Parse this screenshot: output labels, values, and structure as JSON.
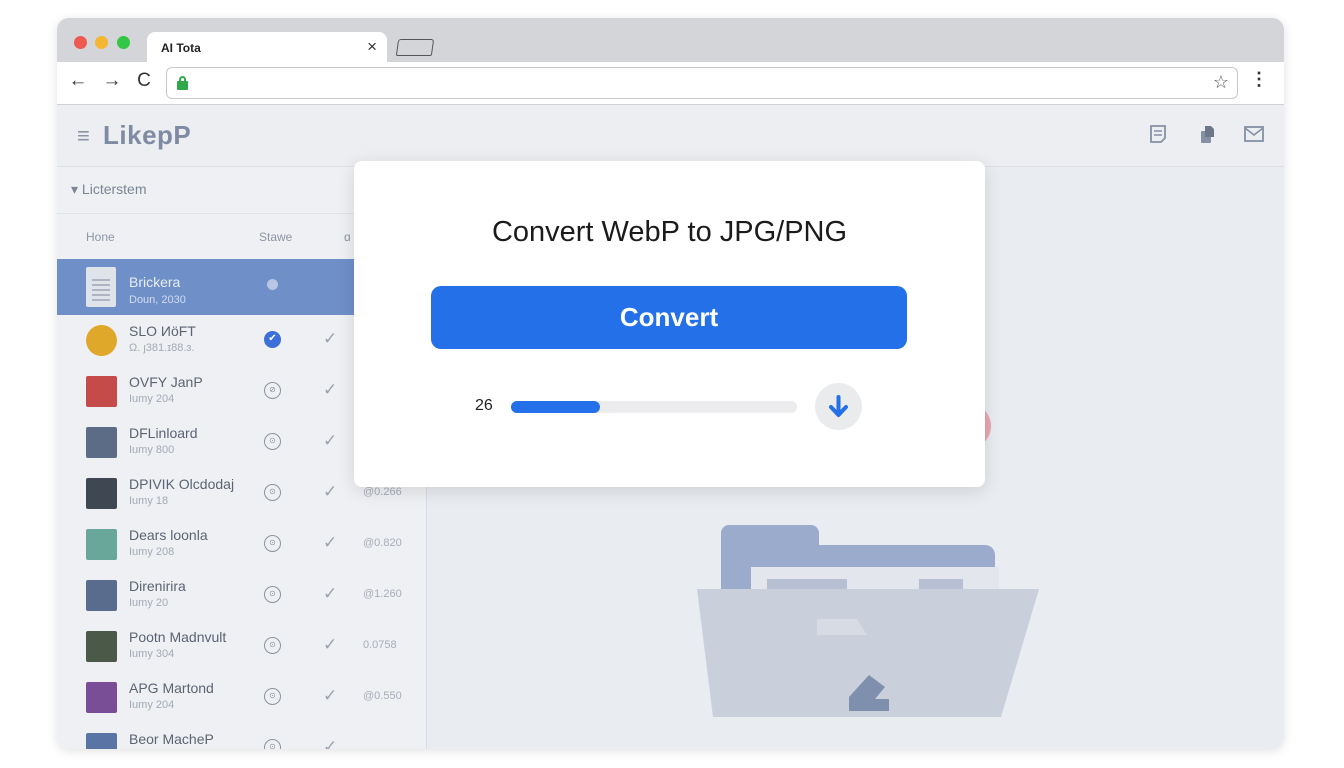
{
  "browser": {
    "tab_title": "AI Tota",
    "tab_close": "×",
    "nav": {
      "back": "←",
      "forward": "→",
      "reload": "C"
    },
    "star": "☆",
    "menu": "⋮"
  },
  "app": {
    "menu_icon": "≡",
    "logo": "LikepP",
    "header_icons": [
      "notes-icon",
      "document-share-icon",
      "mail-icon"
    ]
  },
  "sidebar": {
    "title": "▾ Licterstem",
    "columns": {
      "name": "Hone",
      "status": "Stawe",
      "extra": "ɑ"
    },
    "items": [
      {
        "name": "Brickera",
        "sub": "Doun, 2030",
        "status": "●",
        "check": "",
        "size": "",
        "selected": true,
        "icon": "document-icon"
      },
      {
        "name": "SLO ИöFT",
        "sub": "Ω. ȷ381.ɪ88.ɜ.",
        "status": "✔",
        "check": "✓",
        "size": "",
        "icon": "coin-icon",
        "color": "#e0a82a"
      },
      {
        "name": "OVFY JanP",
        "sub": "Iumy 204",
        "status": "⊘",
        "check": "✓",
        "size": "",
        "icon": "red-image-icon",
        "color": "#c54a4a"
      },
      {
        "name": "DFLinloard",
        "sub": "Iumy 800",
        "status": "⊙",
        "check": "✓",
        "size": "",
        "icon": "photo-icon",
        "color": "#5c6c86"
      },
      {
        "name": "DPIVIK Olcdodaj",
        "sub": "Iumy 18",
        "status": "⊙",
        "check": "✓",
        "size": "@0.266",
        "icon": "photo-icon",
        "color": "#3f4753"
      },
      {
        "name": "Dears loonla",
        "sub": "Iumy 208",
        "status": "⊙",
        "check": "✓",
        "size": "@0.820",
        "icon": "photo-icon",
        "color": "#6aa79b"
      },
      {
        "name": "Direnirira",
        "sub": "Iumy 20",
        "status": "⊙",
        "check": "✓",
        "size": "@1.260",
        "icon": "photo-icon",
        "color": "#5a6c8d"
      },
      {
        "name": "Pootn Madnvult",
        "sub": "Iumy 304",
        "status": "⊙",
        "check": "✓",
        "size": "0.0758",
        "icon": "photo-icon",
        "color": "#4b5948"
      },
      {
        "name": "APG Martond",
        "sub": "Iumy 204",
        "status": "⊙",
        "check": "✓",
        "size": "@0.550",
        "icon": "photo-icon",
        "color": "#7a4d97"
      },
      {
        "name": "Beor MacheP",
        "sub": "",
        "status": "⊙",
        "check": "✓",
        "size": "",
        "icon": "photo-icon",
        "color": "#5a74a6"
      }
    ]
  },
  "dialog": {
    "title": "Convert WebP to JPG/PNG",
    "button": "Convert",
    "progress_label": "26",
    "progress": 0.31,
    "download_icon": "download-arrow-icon"
  },
  "colors": {
    "accent": "#2470e8",
    "selected_row": "#6f8fc9"
  }
}
